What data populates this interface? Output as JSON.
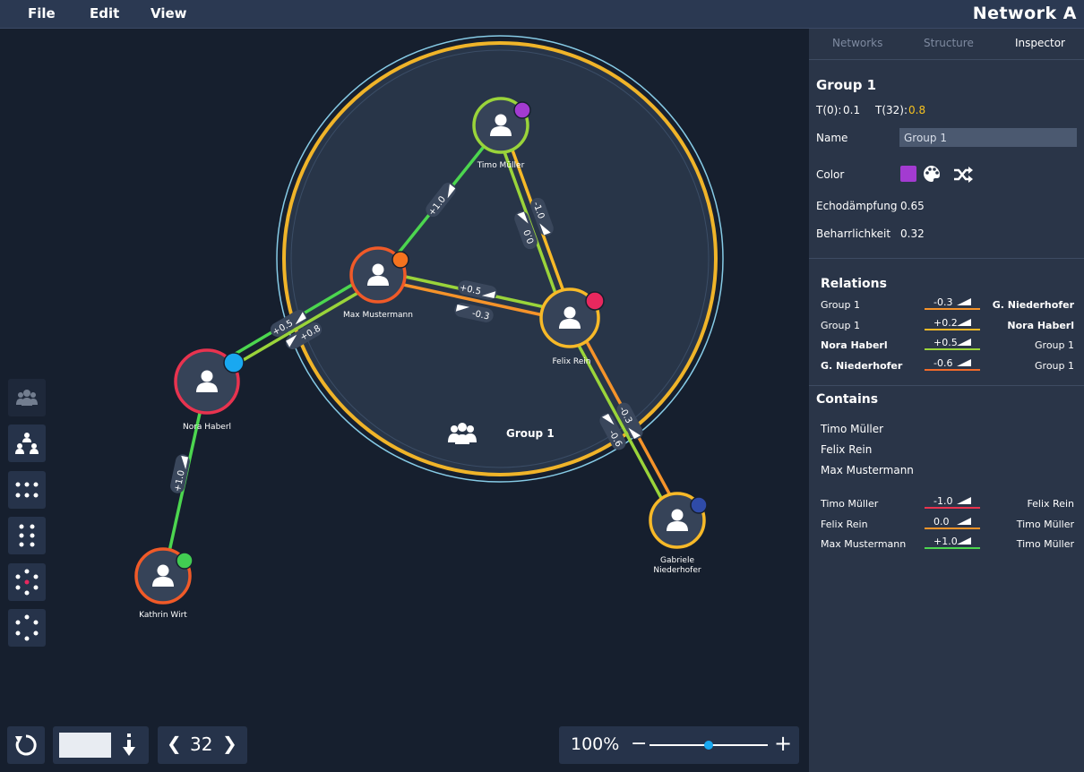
{
  "menu": {
    "file": "File",
    "edit": "Edit",
    "view": "View",
    "title": "Network A"
  },
  "tabs": {
    "networks": "Networks",
    "structure": "Structure",
    "inspector": "Inspector"
  },
  "graph": {
    "group_label": "Group 1",
    "nodes": {
      "timo": "Timo Müller",
      "max": "Max Mustermann",
      "felix": "Felix Rein",
      "nora": "Nora Haberl",
      "kathrin": "Kathrin Wirt",
      "gabriele_1": "Gabriele",
      "gabriele_2": "Niederhofer"
    },
    "edge_labels": {
      "max_timo": "+1.0",
      "timo_felix_a": "-1.0",
      "timo_felix_b": "0.0",
      "max_felix_a": "+0.5",
      "max_felix_b": "-0.3",
      "nora_max_a": "+0.5",
      "nora_max_b": "+0.8",
      "kathrin_nora": "+1.0",
      "felix_gab_a": "-0.3",
      "felix_gab_b": "-0.6"
    },
    "colors": {
      "green": "#4cd64f",
      "yellow_green": "#9ad43a",
      "orange": "#f5932a",
      "amber": "#f7b928",
      "group_ring": "#f0b429",
      "outer_ring": "#86cbe6"
    }
  },
  "bottom": {
    "frame": "32",
    "zoom": "100%",
    "zoom_minus": "−",
    "zoom_plus": "+",
    "zoom_level": 0.5
  },
  "inspector": {
    "heading": "Group 1",
    "t0_label": "T(0):",
    "t0_value": "0.1",
    "t32_label": "T(32):",
    "t32_value": "0.8",
    "name_label": "Name",
    "name_value": "Group 1",
    "color_label": "Color",
    "color_value": "#a33bd1",
    "echo_label": "Echodämpfung",
    "echo_value": "0.65",
    "persist_label": "Beharrlichkeit",
    "persist_value": "0.32",
    "relations_heading": "Relations",
    "relations": [
      {
        "from": "Group 1",
        "value": "-0.3",
        "to": "G. Niederhofer",
        "color": "#f5932a",
        "from_bold": false,
        "to_bold": true
      },
      {
        "from": "Group 1",
        "value": "+0.2",
        "to": "Nora Haberl",
        "color": "#f7b928",
        "from_bold": false,
        "to_bold": true
      },
      {
        "from": "Nora Haberl",
        "value": "+0.5",
        "to": "Group 1",
        "color": "#9ad43a",
        "from_bold": true,
        "to_bold": false
      },
      {
        "from": "G. Niederhofer",
        "value": "-0.6",
        "to": "Group 1",
        "color": "#f06a2a",
        "from_bold": true,
        "to_bold": false
      }
    ],
    "contains_heading": "Contains",
    "members": [
      "Timo Müller",
      "Felix Rein",
      "Max Mustermann"
    ],
    "member_relations": [
      {
        "from": "Timo Müller",
        "value": "-1.0",
        "to": "Felix Rein",
        "color": "#e8334f"
      },
      {
        "from": "Felix Rein",
        "value": "0.0",
        "to": "Timo Müller",
        "color": "#f5932a"
      },
      {
        "from": "Max Mustermann",
        "value": "+1.0",
        "to": "Timo Müller",
        "color": "#4cd64f"
      }
    ]
  }
}
